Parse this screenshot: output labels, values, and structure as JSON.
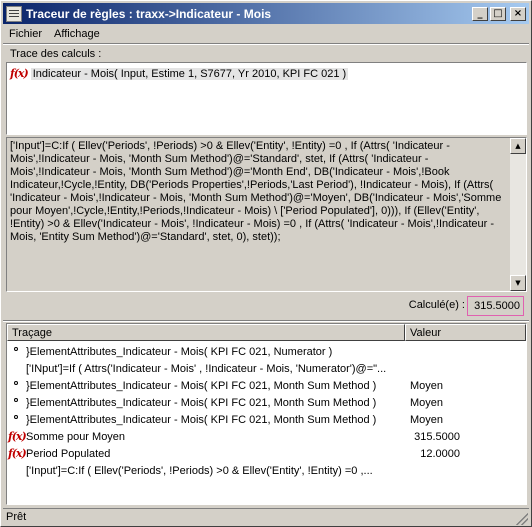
{
  "window": {
    "title": "Traceur de règles : traxx->Indicateur - Mois",
    "minimize_label": "_",
    "maximize_label": "□",
    "close_label": "×"
  },
  "menu": [
    {
      "label": "Fichier"
    },
    {
      "label": "Affichage"
    }
  ],
  "trace": {
    "section_label": "Trace des calculs :",
    "fx_label": "f(x)",
    "entry": "Indicateur - Mois( Input, Estime 1, S7677, Yr 2010, KPI FC 021 )"
  },
  "formula": "['Input']=C:If ( Ellev('Periods', !Periods) >0 &      Ellev('Entity', !Entity) =0 ,   If (Attrs( 'Indicateur - Mois',!Indicateur - Mois, 'Month Sum Method')@='Standard',         stet,    If (Attrs( 'Indicateur - Mois',!Indicateur - Mois, 'Month Sum Method')@='Month End',   DB('Indicateur - Mois',!Book Indicateur,!Cycle,!Entity, DB('Periods Properties',!Periods,'Last Period'),    !Indicateur - Mois),    If (Attrs( 'Indicateur - Mois',!Indicateur - Mois, 'Month Sum Method')@='Moyen',    DB('Indicateur - Mois','Somme pour Moyen',!Cycle,!Entity,!Periods,!Indicateur - Mois) \\   ['Period Populated'],    0))),  If (Ellev('Entity', !Entity) >0 &     Ellev('Indicateur - Mois', !Indicateur - Mois) =0 ,   If (Attrs( 'Indicateur - Mois',!Indicateur - Mois, 'Entity Sum Method')@='Standard',        stet,          0),  stet));",
  "calc": {
    "label": "Calculé(e) :",
    "value": "315.5000"
  },
  "list": {
    "headers": {
      "name": "Traçage",
      "value": "Valeur"
    },
    "rows": [
      {
        "icon": "bullet",
        "indent": 1,
        "name": "}ElementAttributes_Indicateur - Mois( KPI FC 021, Numerator )",
        "value": ""
      },
      {
        "icon": "none",
        "indent": 2,
        "name": "['INput']=If ( Attrs('Indicateur - Mois' , !Indicateur - Mois, 'Numerator')@=\"...",
        "value": ""
      },
      {
        "icon": "bullet",
        "indent": 1,
        "name": "}ElementAttributes_Indicateur - Mois( KPI FC 021, Month Sum Method )",
        "value": "Moyen"
      },
      {
        "icon": "bullet",
        "indent": 1,
        "name": "}ElementAttributes_Indicateur - Mois( KPI FC 021, Month Sum Method )",
        "value": "Moyen"
      },
      {
        "icon": "bullet",
        "indent": 1,
        "name": "}ElementAttributes_Indicateur - Mois( KPI FC 021, Month Sum Method )",
        "value": "Moyen"
      },
      {
        "icon": "fx",
        "indent": 0,
        "name": "Somme pour Moyen",
        "value": "315.5000"
      },
      {
        "icon": "fx",
        "indent": 0,
        "name": "Period Populated",
        "value": "12.0000"
      },
      {
        "icon": "none",
        "indent": 2,
        "name": "['Input']=C:If ( Ellev('Periods', !Periods) >0 &      Ellev('Entity', !Entity) =0 ,...",
        "value": ""
      }
    ]
  },
  "status": "Prêt"
}
